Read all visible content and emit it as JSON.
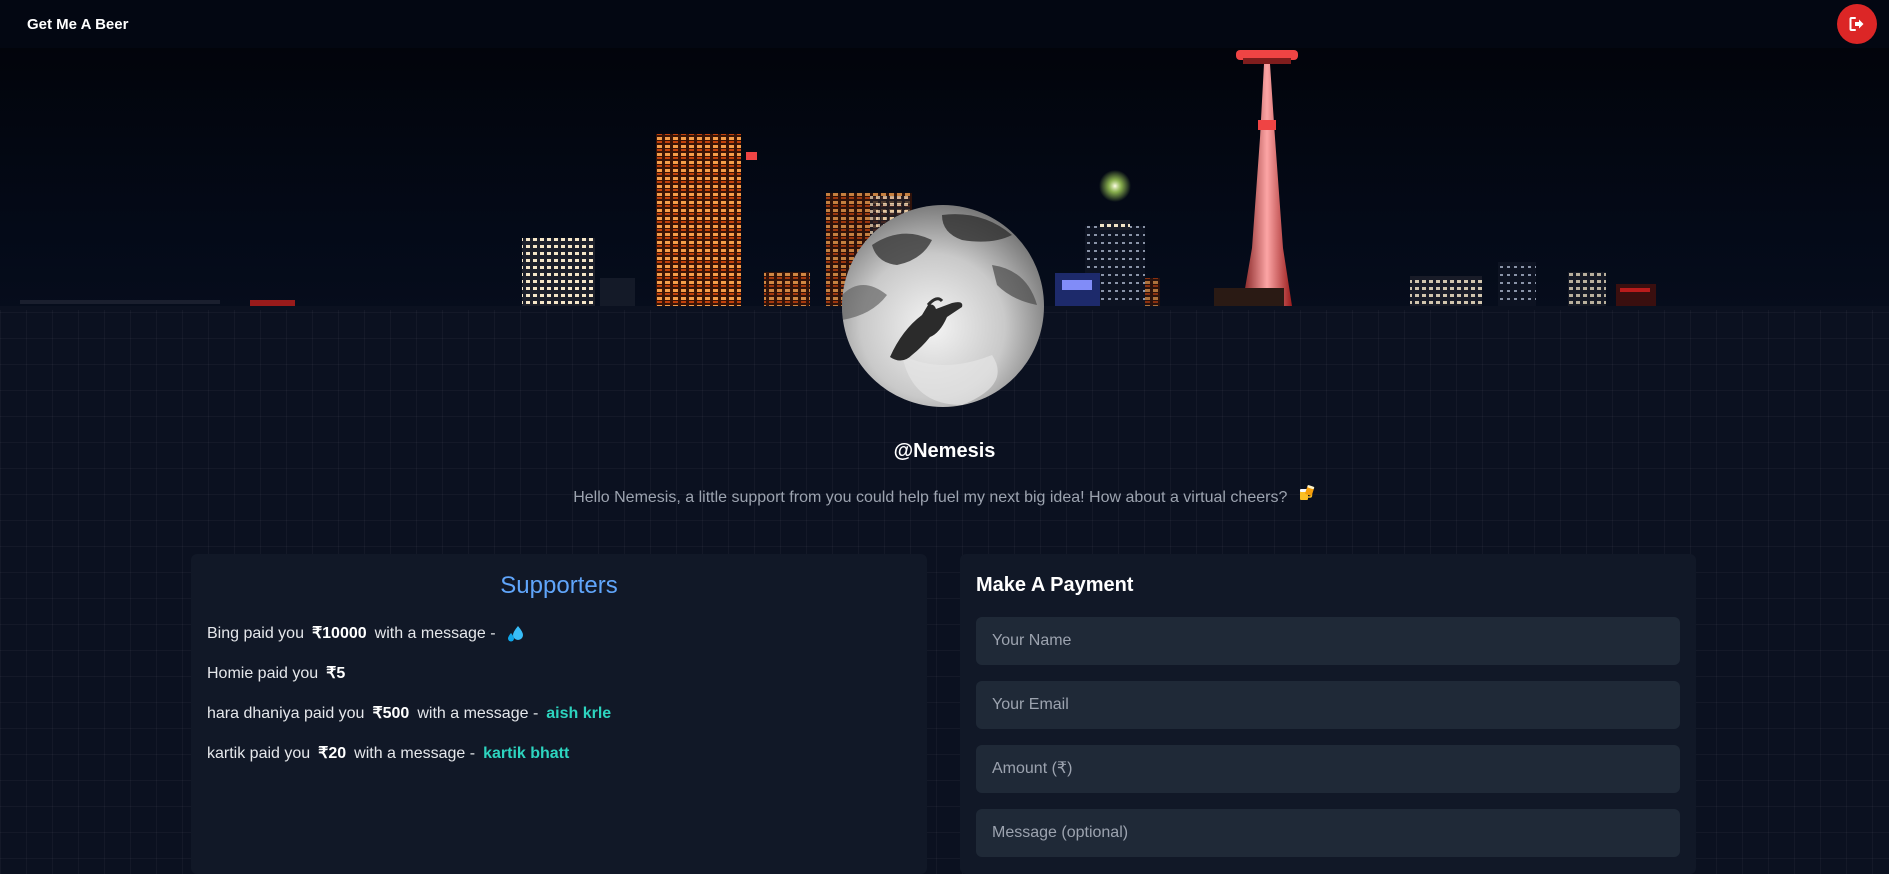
{
  "navbar": {
    "brand": "Get Me A Beer",
    "logout_icon": "logout-icon"
  },
  "profile": {
    "username": "@Nemesis",
    "bio": "Hello Nemesis, a little support from you could help fuel my next big idea! How about a virtual cheers?",
    "bio_icon": "beer-icon"
  },
  "supporters": {
    "title": "Supporters",
    "items": [
      {
        "text": "Bing paid you",
        "amount": "₹10000",
        "connector": "with a message -",
        "message": "",
        "message_icon": "droplets-icon"
      },
      {
        "text": "Homie paid you",
        "amount": "₹5",
        "connector": "",
        "message": ""
      },
      {
        "text": "hara dhaniya paid you",
        "amount": "₹500",
        "connector": "with a message -",
        "message": "aish krle"
      },
      {
        "text": "kartik paid you",
        "amount": "₹20",
        "connector": "with a message -",
        "message": "kartik bhatt"
      }
    ]
  },
  "payment": {
    "title": "Make A Payment",
    "name_placeholder": "Your Name",
    "email_placeholder": "Your Email",
    "amount_placeholder": "Amount (₹)",
    "message_placeholder": "Message (optional)"
  },
  "colors": {
    "accent": "#60a5fa",
    "message": "#2dd4bf",
    "logout": "#dc2626",
    "panel": "#111827"
  }
}
